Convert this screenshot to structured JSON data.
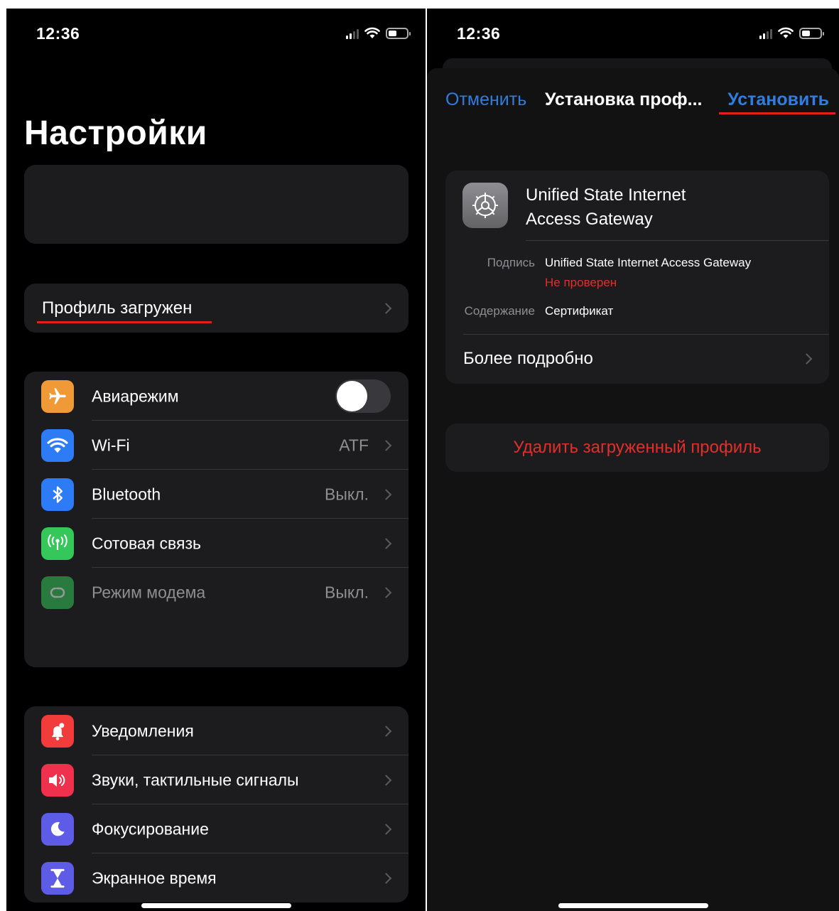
{
  "left": {
    "status": {
      "time": "12:36"
    },
    "title": "Настройки",
    "profile_row": {
      "label": "Профиль загружен"
    },
    "network_rows": [
      {
        "label": "Авиарежим",
        "value": ""
      },
      {
        "label": "Wi-Fi",
        "value": "ATF"
      },
      {
        "label": "Bluetooth",
        "value": "Выкл."
      },
      {
        "label": "Сотовая связь",
        "value": ""
      },
      {
        "label": "Режим модема",
        "value": "Выкл."
      }
    ],
    "general_rows": [
      {
        "label": "Уведомления"
      },
      {
        "label": "Звуки, тактильные сигналы"
      },
      {
        "label": "Фокусирование"
      },
      {
        "label": "Экранное время"
      }
    ],
    "airplane_mode_on": false
  },
  "right": {
    "status": {
      "time": "12:36"
    },
    "nav": {
      "cancel_label": "Отменить",
      "title": "Установка проф...",
      "install_label": "Установить"
    },
    "profile": {
      "name_line1": "Unified State Internet",
      "name_line2": "Access Gateway",
      "signed_label": "Подпись",
      "signed_value": "Unified State Internet Access Gateway",
      "signed_status": "Не проверен",
      "contains_label": "Содержание",
      "contains_value": "Сертификат",
      "more_label": "Более подробно"
    },
    "delete_label": "Удалить загруженный профиль"
  },
  "colors": {
    "accent_blue": "#2f7de0",
    "destructive_red": "#e0302c",
    "annotation_red": "#e0201d"
  }
}
